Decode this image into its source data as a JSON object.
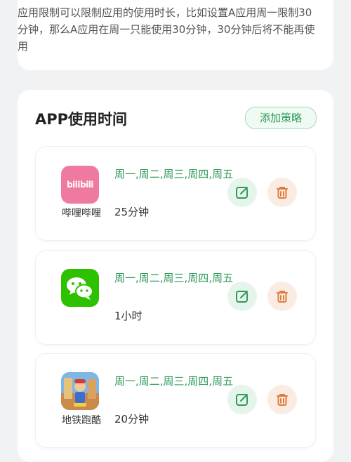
{
  "top": {
    "description": "应用限制可以限制应用的使用时长，比如设置A应用周一限制30分钟，那么A应用在周一只能使用30分钟，30分钟后将不能再使用"
  },
  "section": {
    "title": "APP使用时间",
    "add_button_label": "添加策略"
  },
  "apps": [
    {
      "name": "哔哩哔哩",
      "icon_text": "bilibili",
      "days": "周一,周二,周三,周四,周五",
      "duration": "25分钟"
    },
    {
      "name": "",
      "days": "周一,周二,周三,周四,周五",
      "duration": "1小时"
    },
    {
      "name": "地铁跑酷",
      "days": "周一,周二,周三,周四,周五",
      "duration": "20分钟"
    }
  ],
  "colors": {
    "accent_green": "#2e9a5b",
    "edit_bg": "#e6f5eb",
    "delete_bg": "#fbece3",
    "delete_icon": "#e07b3e",
    "bilibili_pink": "#ef7aa0",
    "wechat_green": "#2dc100"
  },
  "icons": {
    "edit": "edit-icon",
    "delete": "trash-icon"
  }
}
